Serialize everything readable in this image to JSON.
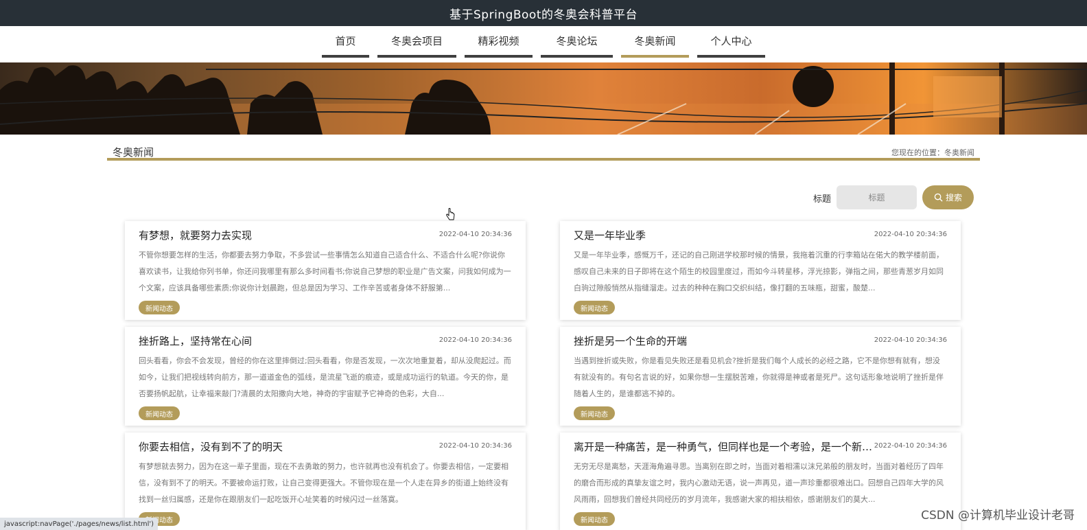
{
  "site": {
    "title": "基于SpringBoot的冬奥会科普平台"
  },
  "nav": [
    {
      "label": "首页"
    },
    {
      "label": "冬奥会项目"
    },
    {
      "label": "精彩视频"
    },
    {
      "label": "冬奥论坛"
    },
    {
      "label": "冬奥新闻"
    },
    {
      "label": "个人中心"
    }
  ],
  "section": {
    "title": "冬奥新闻",
    "crumb": "您现在的位置：冬奥新闻"
  },
  "search": {
    "label": "标题",
    "placeholder": "标题",
    "button": "搜索"
  },
  "news": [
    {
      "title": "有梦想，就要努力去实现",
      "date": "2022-04-10 20:34:36",
      "tag": "新闻动态",
      "body": "不管你想要怎样的生活，你都要去努力争取，不多尝试一些事情怎么知道自己适合什么、不适合什么呢?你说你喜欢读书，让我给你列书单，你还问我哪里有那么多时间看书;你说自己梦想的职业是广告文案，问我如何成为一个文案，应该具备哪些素质;你说你计划晨跑，但总是因为学习、工作辛苦或者身体不舒服第..."
    },
    {
      "title": "又是一年毕业季",
      "date": "2022-04-10 20:34:36",
      "tag": "新闻动态",
      "body": "又是一年毕业季，感慨万千，还记的自己刚进学校那时候的情景，我拖着沉重的行李箱站在偌大的教学楼前面，感叹自己未来的日子即将在这个陌生的校园里度过，而如今斗转星移，浮光掠影，弹指之间，那些青葱岁月如同白驹过隙般悄然从指缝溜走。过去的种种在胸口交织纠结，像打翻的五味瓶，甜蜜，酸楚..."
    },
    {
      "title": "挫折路上，坚持常在心间",
      "date": "2022-04-10 20:34:36",
      "tag": "新闻动态",
      "body": "回头看看，你会不会发现，曾经的你在这里摔倒过;回头看看，你是否发现，一次次地重复着，却从没爬起过。而如今，让我们把视线转向前方，那一道道金色的弧线，是流星飞逝的痕迹，或是成功运行的轨道。今天的你，是否要扬帆起航，让幸福来敲门?清晨的太阳撒向大地，神奇的宇宙赋予它神奇的色彩，大自..."
    },
    {
      "title": "挫折是另一个生命的开端",
      "date": "2022-04-10 20:34:36",
      "tag": "新闻动态",
      "body": "当遇到挫折或失败，你是看见失败还是看见机会?挫折是我们每个人成长的必经之路，它不是你想有就有，想没有就没有的。有句名言说的好，如果你想一生摆脱苦难，你就得是神或者是死尸。这句话形象地说明了挫折是伴随着人生的，是谁都逃不掉的。"
    },
    {
      "title": "你要去相信，没有到不了的明天",
      "date": "2022-04-10 20:34:36",
      "tag": "新闻动态",
      "body": "有梦想就去努力，因为在这一辈子里面，现在不去勇敢的努力，也许就再也没有机会了。你要去相信，一定要相信，没有到不了的明天。不要被命运打败，让自己变得更强大。不管你现在是一个人走在异乡的街道上始终没有找到一丝归属感，还是你在跟朋友们一起吃饭开心址笑着的时候闪过一丝落寞。"
    },
    {
      "title": "离开是一种痛苦，是一种勇气，但同样也是一个考验，是一个新的...",
      "date": "2022-04-10 20:34:36",
      "tag": "新闻动态",
      "body": "无穷无尽是离愁，天涯海角遍寻思。当离别在即之时，当面对着相濡以沫兄弟般的朋友时，当面对着经历了四年的磨合而形成的真挚友谊之时，我内心激动无语，说一声再见，道一声珍重都很难出口。回想自己四年大学的风风雨雨，回想我们曾经共同经历的岁月流年，我感谢大家的相扶相依，感谢朋友们的莫大..."
    }
  ],
  "status": {
    "url": "javascript:navPage('./pages/news/list.html')"
  },
  "watermark": "CSDN @计算机毕业设计老哥",
  "colors": {
    "accent": "#b39c5a",
    "topbar": "#283037",
    "nav_border": "#3f3f3f"
  }
}
